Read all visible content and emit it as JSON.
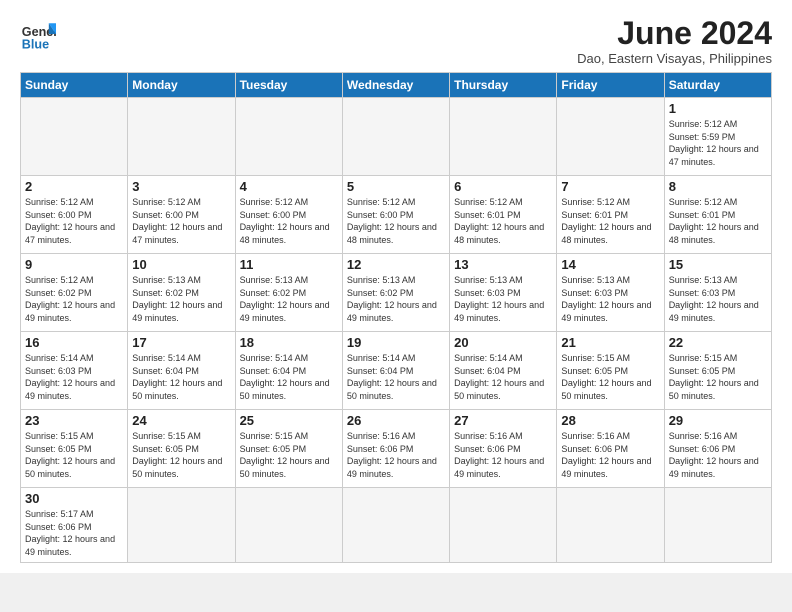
{
  "header": {
    "logo_line1": "General",
    "logo_line2": "Blue",
    "month_title": "June 2024",
    "subtitle": "Dao, Eastern Visayas, Philippines"
  },
  "weekdays": [
    "Sunday",
    "Monday",
    "Tuesday",
    "Wednesday",
    "Thursday",
    "Friday",
    "Saturday"
  ],
  "days": {
    "d1": {
      "num": "1",
      "sunrise": "5:12 AM",
      "sunset": "5:59 PM",
      "daylight": "12 hours and 47 minutes."
    },
    "d2": {
      "num": "2",
      "sunrise": "5:12 AM",
      "sunset": "6:00 PM",
      "daylight": "12 hours and 47 minutes."
    },
    "d3": {
      "num": "3",
      "sunrise": "5:12 AM",
      "sunset": "6:00 PM",
      "daylight": "12 hours and 47 minutes."
    },
    "d4": {
      "num": "4",
      "sunrise": "5:12 AM",
      "sunset": "6:00 PM",
      "daylight": "12 hours and 48 minutes."
    },
    "d5": {
      "num": "5",
      "sunrise": "5:12 AM",
      "sunset": "6:00 PM",
      "daylight": "12 hours and 48 minutes."
    },
    "d6": {
      "num": "6",
      "sunrise": "5:12 AM",
      "sunset": "6:01 PM",
      "daylight": "12 hours and 48 minutes."
    },
    "d7": {
      "num": "7",
      "sunrise": "5:12 AM",
      "sunset": "6:01 PM",
      "daylight": "12 hours and 48 minutes."
    },
    "d8": {
      "num": "8",
      "sunrise": "5:12 AM",
      "sunset": "6:01 PM",
      "daylight": "12 hours and 48 minutes."
    },
    "d9": {
      "num": "9",
      "sunrise": "5:12 AM",
      "sunset": "6:02 PM",
      "daylight": "12 hours and 49 minutes."
    },
    "d10": {
      "num": "10",
      "sunrise": "5:13 AM",
      "sunset": "6:02 PM",
      "daylight": "12 hours and 49 minutes."
    },
    "d11": {
      "num": "11",
      "sunrise": "5:13 AM",
      "sunset": "6:02 PM",
      "daylight": "12 hours and 49 minutes."
    },
    "d12": {
      "num": "12",
      "sunrise": "5:13 AM",
      "sunset": "6:02 PM",
      "daylight": "12 hours and 49 minutes."
    },
    "d13": {
      "num": "13",
      "sunrise": "5:13 AM",
      "sunset": "6:03 PM",
      "daylight": "12 hours and 49 minutes."
    },
    "d14": {
      "num": "14",
      "sunrise": "5:13 AM",
      "sunset": "6:03 PM",
      "daylight": "12 hours and 49 minutes."
    },
    "d15": {
      "num": "15",
      "sunrise": "5:13 AM",
      "sunset": "6:03 PM",
      "daylight": "12 hours and 49 minutes."
    },
    "d16": {
      "num": "16",
      "sunrise": "5:14 AM",
      "sunset": "6:03 PM",
      "daylight": "12 hours and 49 minutes."
    },
    "d17": {
      "num": "17",
      "sunrise": "5:14 AM",
      "sunset": "6:04 PM",
      "daylight": "12 hours and 50 minutes."
    },
    "d18": {
      "num": "18",
      "sunrise": "5:14 AM",
      "sunset": "6:04 PM",
      "daylight": "12 hours and 50 minutes."
    },
    "d19": {
      "num": "19",
      "sunrise": "5:14 AM",
      "sunset": "6:04 PM",
      "daylight": "12 hours and 50 minutes."
    },
    "d20": {
      "num": "20",
      "sunrise": "5:14 AM",
      "sunset": "6:04 PM",
      "daylight": "12 hours and 50 minutes."
    },
    "d21": {
      "num": "21",
      "sunrise": "5:15 AM",
      "sunset": "6:05 PM",
      "daylight": "12 hours and 50 minutes."
    },
    "d22": {
      "num": "22",
      "sunrise": "5:15 AM",
      "sunset": "6:05 PM",
      "daylight": "12 hours and 50 minutes."
    },
    "d23": {
      "num": "23",
      "sunrise": "5:15 AM",
      "sunset": "6:05 PM",
      "daylight": "12 hours and 50 minutes."
    },
    "d24": {
      "num": "24",
      "sunrise": "5:15 AM",
      "sunset": "6:05 PM",
      "daylight": "12 hours and 50 minutes."
    },
    "d25": {
      "num": "25",
      "sunrise": "5:15 AM",
      "sunset": "6:05 PM",
      "daylight": "12 hours and 50 minutes."
    },
    "d26": {
      "num": "26",
      "sunrise": "5:16 AM",
      "sunset": "6:06 PM",
      "daylight": "12 hours and 49 minutes."
    },
    "d27": {
      "num": "27",
      "sunrise": "5:16 AM",
      "sunset": "6:06 PM",
      "daylight": "12 hours and 49 minutes."
    },
    "d28": {
      "num": "28",
      "sunrise": "5:16 AM",
      "sunset": "6:06 PM",
      "daylight": "12 hours and 49 minutes."
    },
    "d29": {
      "num": "29",
      "sunrise": "5:16 AM",
      "sunset": "6:06 PM",
      "daylight": "12 hours and 49 minutes."
    },
    "d30": {
      "num": "30",
      "sunrise": "5:17 AM",
      "sunset": "6:06 PM",
      "daylight": "12 hours and 49 minutes."
    }
  }
}
